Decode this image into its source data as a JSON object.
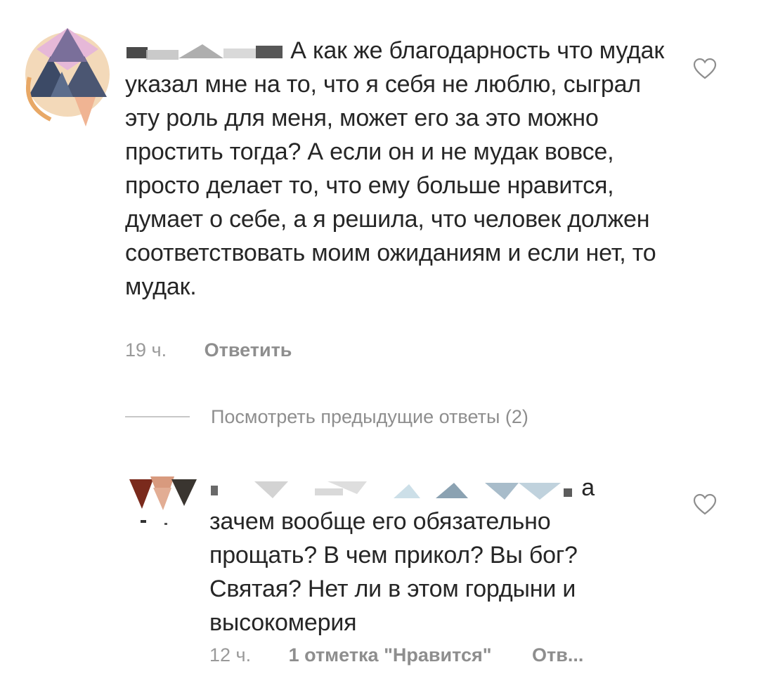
{
  "comments": [
    {
      "text_first_line": "А как же благодарность что",
      "text_rest": "мудак указал мне на то, что я себя не люблю, сыграл эту роль для меня, может его за это можно простить тогда? А если он и не мудак вовсе, просто делает то, что ему больше нравится, думает о себе, а я решила, что человек должен соответствовать моим ожиданиям и если нет, то мудак.",
      "time": "19 ч.",
      "reply_label": "Ответить",
      "like_icon": "heart-outline-icon"
    },
    {
      "text_first_line": "а",
      "text_rest": "зачем вообще его обязательно прощать? В чем прикол? Вы бог? Святая? Нет ли в этом гордыни и высокомерия",
      "time": "12 ч.",
      "likes_label": "1 отметка \"Нравится\"",
      "reply_label": "Отв...",
      "like_icon": "heart-outline-icon"
    }
  ],
  "view_previous_replies": "Посмотреть предыдущие ответы (2)",
  "colors": {
    "text": "#262626",
    "secondary": "#8e8e8e",
    "divider": "#c7c7c7"
  }
}
